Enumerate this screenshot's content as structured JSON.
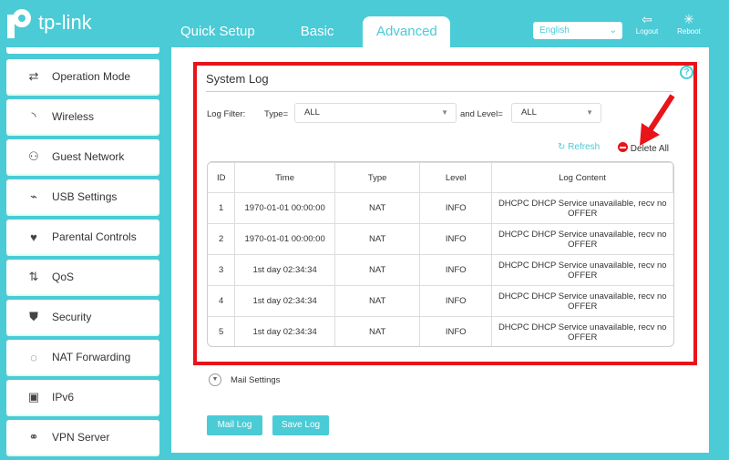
{
  "brand": {
    "logo_text": "tp-link"
  },
  "nav": {
    "tabs": [
      {
        "label": "Quick Setup"
      },
      {
        "label": "Basic"
      },
      {
        "label": "Advanced",
        "active": true
      }
    ]
  },
  "header": {
    "language": "English",
    "logout": "Logout",
    "reboot": "Reboot"
  },
  "sidebar": {
    "items": [
      {
        "label": "Operation Mode",
        "icon": "operation-mode-icon"
      },
      {
        "label": "Wireless",
        "icon": "wifi-icon"
      },
      {
        "label": "Guest Network",
        "icon": "guest-icon"
      },
      {
        "label": "USB Settings",
        "icon": "usb-icon"
      },
      {
        "label": "Parental Controls",
        "icon": "heart-icon"
      },
      {
        "label": "QoS",
        "icon": "qos-icon"
      },
      {
        "label": "Security",
        "icon": "shield-icon"
      },
      {
        "label": "NAT Forwarding",
        "icon": "nat-icon"
      },
      {
        "label": "IPv6",
        "icon": "ipv6-icon"
      },
      {
        "label": "VPN Server",
        "icon": "link-icon"
      }
    ]
  },
  "syslog": {
    "title": "System Log",
    "filter_label": "Log Filter:",
    "type_label": "Type=",
    "type_value": "ALL",
    "level_label": "and Level=",
    "level_value": "ALL",
    "refresh": "Refresh",
    "delete_all": "Delete All",
    "columns": [
      "ID",
      "Time",
      "Type",
      "Level",
      "Log Content"
    ],
    "rows": [
      [
        "1",
        "1970-01-01 00:00:00",
        "NAT",
        "INFO",
        "DHCPC DHCP Service unavailable, recv no OFFER"
      ],
      [
        "2",
        "1970-01-01 00:00:00",
        "NAT",
        "INFO",
        "DHCPC DHCP Service unavailable, recv no OFFER"
      ],
      [
        "3",
        "1st day 02:34:34",
        "NAT",
        "INFO",
        "DHCPC DHCP Service unavailable, recv no OFFER"
      ],
      [
        "4",
        "1st day 02:34:34",
        "NAT",
        "INFO",
        "DHCPC DHCP Service unavailable, recv no OFFER"
      ],
      [
        "5",
        "1st day 02:34:34",
        "NAT",
        "INFO",
        "DHCPC DHCP Service unavailable, recv no OFFER"
      ]
    ]
  },
  "mail_settings": "Mail Settings",
  "buttons": {
    "mail_log": "Mail Log",
    "save_log": "Save Log"
  },
  "colors": {
    "accent": "#4acbd6",
    "highlight": "#e8141a"
  }
}
